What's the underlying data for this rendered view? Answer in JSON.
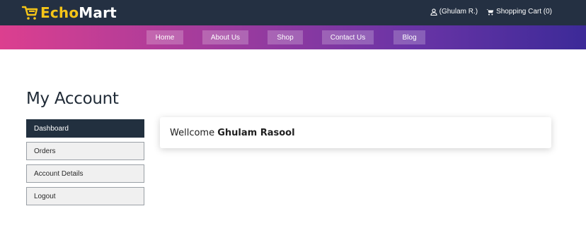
{
  "brand": {
    "part1": "Echo",
    "part2": "Mart",
    "accent_color": "#f5c518",
    "icon": "cart-logo-icon"
  },
  "header": {
    "user_label": "(Ghulam R.)",
    "user_icon": "user-icon",
    "cart_label": "Shopping Cart (0)",
    "cart_icon": "cart-icon",
    "bg_color": "#243042"
  },
  "nav": {
    "items": [
      {
        "label": "Home"
      },
      {
        "label": "About Us"
      },
      {
        "label": "Shop"
      },
      {
        "label": "Contact Us"
      },
      {
        "label": "Blog"
      }
    ],
    "gradient": [
      "#dc3f8f",
      "#3c2a98"
    ]
  },
  "account": {
    "title": "My Account",
    "menu": [
      {
        "label": "Dashboard",
        "active": true
      },
      {
        "label": "Orders",
        "active": false
      },
      {
        "label": "Account Details",
        "active": false
      },
      {
        "label": "Logout",
        "active": false
      }
    ],
    "welcome_prefix": "Wellcome ",
    "welcome_name": "Ghulam Rasool"
  }
}
